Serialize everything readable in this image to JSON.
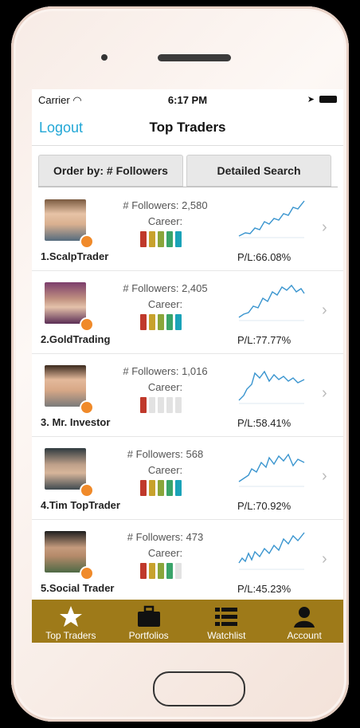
{
  "status": {
    "carrier": "Carrier",
    "time": "6:17 PM"
  },
  "nav": {
    "logout": "Logout",
    "title": "Top Traders"
  },
  "segments": {
    "order": "Order by: # Followers",
    "search": "Detailed Search"
  },
  "traders": [
    {
      "name": "1.ScalpTrader",
      "followers": "# Followers: 2,580",
      "career": "Career:",
      "pl": "P/L:66.08%",
      "career_level": 5
    },
    {
      "name": "2.GoldTrading",
      "followers": "# Followers: 2,405",
      "career": "Career:",
      "pl": "P/L:77.77%",
      "career_level": 5
    },
    {
      "name": "3. Mr. Investor",
      "followers": "# Followers: 1,016",
      "career": "Career:",
      "pl": "P/L:58.41%",
      "career_level": 1
    },
    {
      "name": "4.Tim TopTrader",
      "followers": "# Followers: 568",
      "career": "Career:",
      "pl": "P/L:70.92%",
      "career_level": 5
    },
    {
      "name": "5.Social Trader",
      "followers": "# Followers: 473",
      "career": "Career:",
      "pl": "P/L:45.23%",
      "career_level": 4
    }
  ],
  "tabs": {
    "top_traders": "Top Traders",
    "portfolios": "Portfolios",
    "watchlist": "Watchlist",
    "account": "Account"
  },
  "colors": {
    "accent": "#22a7d6",
    "tabbar": "#9e7a19",
    "career": [
      "#c0392b",
      "#c8a22c",
      "#8aa53a",
      "#3aa46a",
      "#1aa3b8"
    ],
    "career_empty": "#e2e2e2",
    "spark": "#3a95cf",
    "badge": "#f08a2a"
  }
}
